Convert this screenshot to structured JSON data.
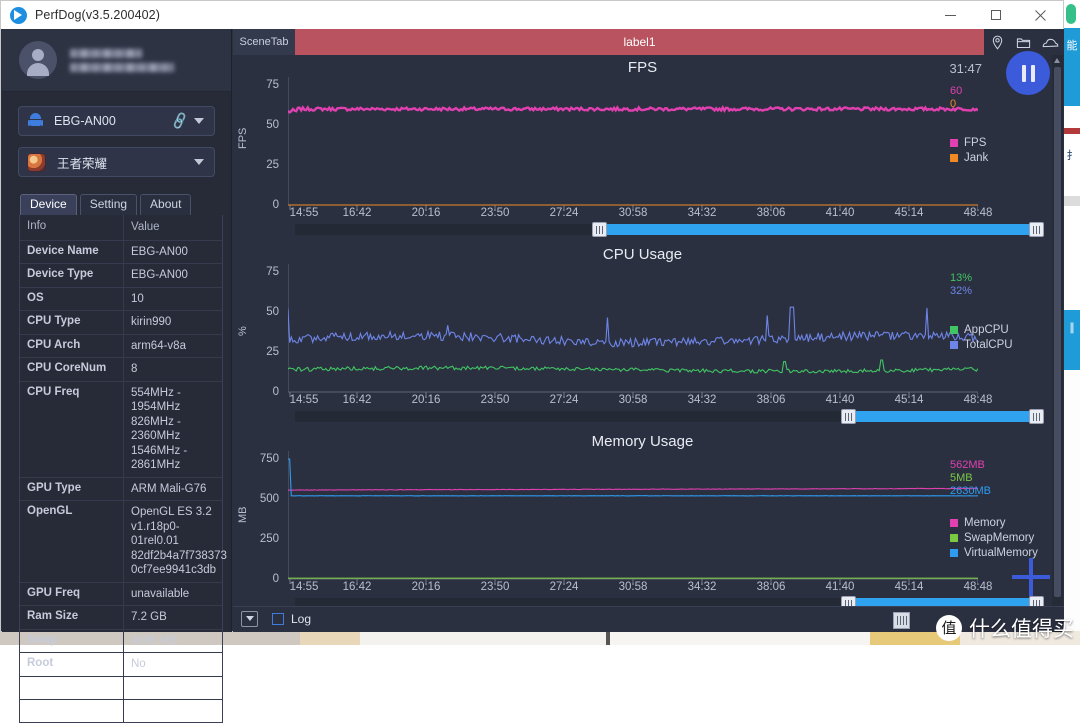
{
  "window": {
    "title": "PerfDog(v3.5.200402)",
    "controls": {
      "minimize": "minimize-button",
      "maximize": "maximize-button",
      "close": "close-button"
    }
  },
  "sidebar": {
    "account": {
      "name_redacted": "",
      "email_redacted": ""
    },
    "device_select": {
      "value": "EBG-AN00",
      "link_icon": "link-icon",
      "caret": "chevron-down-icon"
    },
    "app_select": {
      "value": "王者荣耀",
      "caret": "chevron-down-icon"
    },
    "tabs": [
      {
        "label": "Device",
        "active": true
      },
      {
        "label": "Setting",
        "active": false
      },
      {
        "label": "About",
        "active": false
      }
    ],
    "table": {
      "headers": [
        "Info",
        "Value"
      ],
      "rows": [
        {
          "key": "Device Name",
          "value": "EBG-AN00"
        },
        {
          "key": "Device Type",
          "value": "EBG-AN00"
        },
        {
          "key": "OS",
          "value": "10"
        },
        {
          "key": "CPU Type",
          "value": "kirin990"
        },
        {
          "key": "CPU Arch",
          "value": "arm64-v8a"
        },
        {
          "key": "CPU CoreNum",
          "value": "8"
        },
        {
          "key": "CPU Freq",
          "value": "554MHz - 1954MHz\n826MHz - 2360MHz\n1546MHz -\n2861MHz"
        },
        {
          "key": "GPU Type",
          "value": "ARM Mali-G76"
        },
        {
          "key": "OpenGL",
          "value": "OpenGL ES 3.2\nv1.r18p0-01rel0.01\n82df2b4a7f738373\n0cf7ee9941c3db"
        },
        {
          "key": "GPU Freq",
          "value": "unavailable"
        },
        {
          "key": "Ram Size",
          "value": "7.2 GB"
        },
        {
          "key": "Swap",
          "value": "4095 MB"
        },
        {
          "key": "Root",
          "value": "No"
        },
        {
          "key": "",
          "value": ""
        },
        {
          "key": "",
          "value": ""
        }
      ]
    }
  },
  "scenebar": {
    "label": "SceneTab",
    "tab_label": "label1",
    "tab_color": "#b9535f",
    "icons": [
      "location-pin-icon",
      "folder-icon",
      "cloud-icon"
    ]
  },
  "session": {
    "elapsed": "31:47",
    "pause_button": "pause-button"
  },
  "bottom": {
    "collapse_button": "collapse-button",
    "log_label": "Log",
    "log_checked": false
  },
  "watermark": {
    "badge": "值",
    "text": "什么值得买"
  },
  "add_button": "add-metric-button",
  "chart_data": [
    {
      "type": "line",
      "title": "FPS",
      "ylabel": "FPS",
      "xlabel": "",
      "ylim": [
        0,
        80
      ],
      "yticks": [
        0,
        25,
        50,
        75
      ],
      "xticks": [
        "14:55",
        "16:42",
        "20:16",
        "23:50",
        "27:24",
        "30:58",
        "34:32",
        "38:06",
        "41:40",
        "45:14",
        "48:48"
      ],
      "grid": false,
      "legend_position": "right",
      "series": [
        {
          "name": "FPS",
          "color": "#e040b0",
          "current_value": "60",
          "mean": 60,
          "min": 56,
          "max": 61
        },
        {
          "name": "Jank",
          "color": "#f08a22",
          "current_value": "0",
          "mean": 0,
          "min": 0,
          "max": 0
        }
      ]
    },
    {
      "type": "line",
      "title": "CPU Usage",
      "ylabel": "%",
      "xlabel": "",
      "ylim": [
        0,
        80
      ],
      "yticks": [
        0,
        25,
        50,
        75
      ],
      "xticks": [
        "14:55",
        "16:42",
        "20:16",
        "23:50",
        "27:24",
        "30:58",
        "34:32",
        "38:06",
        "41:40",
        "45:14",
        "48:48"
      ],
      "grid": false,
      "legend_position": "right",
      "series": [
        {
          "name": "AppCPU",
          "color": "#41c463",
          "current_value": "13%",
          "mean": 14,
          "min": 11,
          "max": 20
        },
        {
          "name": "TotalCPU",
          "color": "#6e85e8",
          "current_value": "32%",
          "mean": 33,
          "min": 28,
          "max": 53
        }
      ]
    },
    {
      "type": "line",
      "title": "Memory Usage",
      "ylabel": "MB",
      "xlabel": "",
      "ylim": [
        0,
        800
      ],
      "yticks": [
        0,
        250,
        500,
        750
      ],
      "xticks": [
        "14:55",
        "16:42",
        "20:16",
        "23:50",
        "27:24",
        "30:58",
        "34:32",
        "38:06",
        "41:40",
        "45:14",
        "48:48"
      ],
      "grid": false,
      "legend_position": "right",
      "series": [
        {
          "name": "Memory",
          "color": "#e040b0",
          "current_value": "562MB",
          "mean": 560,
          "min": 548,
          "max": 566
        },
        {
          "name": "SwapMemory",
          "color": "#7ac943",
          "current_value": "5MB",
          "mean": 5,
          "min": 4,
          "max": 6
        },
        {
          "name": "VirtualMemory",
          "color": "#2f9bf0",
          "current_value": "2630MB",
          "mean": 520,
          "min": 515,
          "max": 750
        }
      ]
    }
  ]
}
